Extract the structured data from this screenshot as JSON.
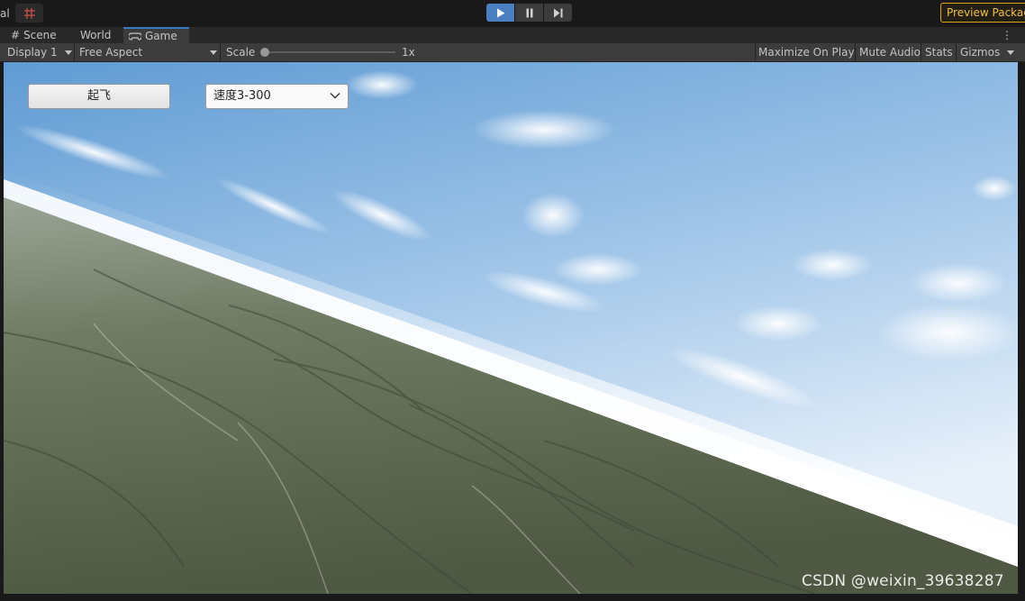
{
  "toolbar": {
    "left_label": "al",
    "play_icon": "play-icon",
    "pause_icon": "pause-icon",
    "step_icon": "step-icon",
    "preview_packages": "Preview Packag",
    "colors": {
      "play_active": "#4a7fc1",
      "preview_border": "#e0a21c"
    }
  },
  "tabs": [
    {
      "label": "Scene",
      "icon": "grid-icon"
    },
    {
      "label": "World"
    },
    {
      "label": "Game",
      "icon": "gamepad-icon",
      "active": true
    }
  ],
  "options_bar": {
    "display": "Display 1",
    "aspect": "Free Aspect",
    "scale_label": "Scale",
    "scale_value": "1x",
    "maximize_on_play": "Maximize On Play",
    "mute_audio": "Mute Audio",
    "stats": "Stats",
    "gizmos": "Gizmos"
  },
  "game_ui": {
    "takeoff_button": "起飞",
    "speed_dropdown": "速度3-300"
  },
  "watermark": "CSDN @weixin_39638287"
}
